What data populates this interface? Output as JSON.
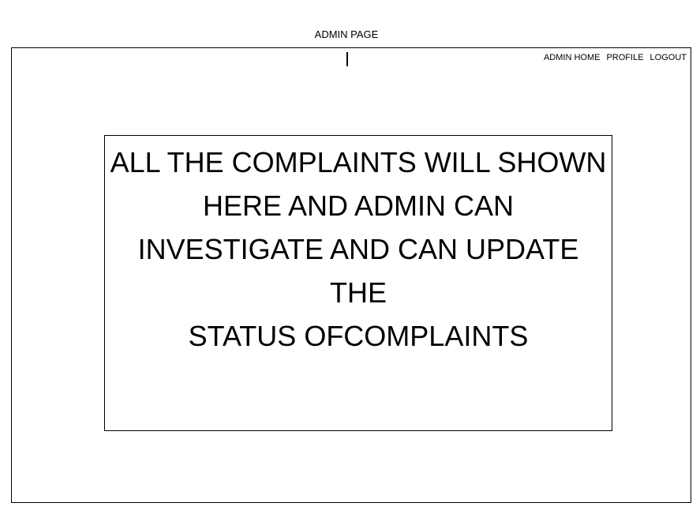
{
  "header": {
    "title": "ADMIN PAGE"
  },
  "nav": {
    "items": [
      {
        "label": "ADMIN HOME"
      },
      {
        "label": "PROFILE"
      },
      {
        "label": "LOGOUT"
      }
    ]
  },
  "main": {
    "message_lines": [
      "ALL THE COMPLAINTS WILL SHOWN",
      "HERE AND ADMIN CAN",
      "INVESTIGATE AND CAN UPDATE THE",
      "STATUS OFCOMPLAINTS"
    ]
  }
}
